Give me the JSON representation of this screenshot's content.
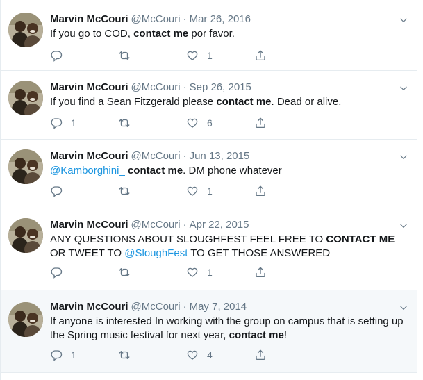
{
  "tweets": [
    {
      "name": "Marvin McCouri",
      "handle": "@McCouri",
      "separator": "·",
      "date": "Mar 26, 2016",
      "parts": [
        {
          "t": "If you go to COD, "
        },
        {
          "t": "contact me",
          "b": true
        },
        {
          "t": " por favor."
        }
      ],
      "replies": "",
      "retweets": "",
      "likes": "1"
    },
    {
      "name": "Marvin McCouri",
      "handle": "@McCouri",
      "separator": "·",
      "date": "Sep 26, 2015",
      "parts": [
        {
          "t": "If you find a Sean Fitzgerald please "
        },
        {
          "t": "contact me",
          "b": true
        },
        {
          "t": ". Dead or alive."
        }
      ],
      "replies": "1",
      "retweets": "",
      "likes": "6"
    },
    {
      "name": "Marvin McCouri",
      "handle": "@McCouri",
      "separator": "·",
      "date": "Jun 13, 2015",
      "parts": [
        {
          "t": "@Kamborghini_",
          "m": true
        },
        {
          "t": " "
        },
        {
          "t": "contact me",
          "b": true
        },
        {
          "t": ". DM phone whatever"
        }
      ],
      "replies": "",
      "retweets": "",
      "likes": "1"
    },
    {
      "name": "Marvin McCouri",
      "handle": "@McCouri",
      "separator": "·",
      "date": "Apr 22, 2015",
      "parts": [
        {
          "t": "ANY QUESTIONS ABOUT SLOUGHFEST FEEL FREE TO "
        },
        {
          "t": "CONTACT ME",
          "b": true
        },
        {
          "t": " OR TWEET TO "
        },
        {
          "t": "@SloughFest",
          "m": true
        },
        {
          "t": " TO GET THOSE ANSWERED"
        }
      ],
      "replies": "",
      "retweets": "",
      "likes": "1"
    },
    {
      "name": "Marvin McCouri",
      "handle": "@McCouri",
      "separator": "·",
      "date": "May 7, 2014",
      "parts": [
        {
          "t": "If anyone is interested In working with the group on campus that is setting up the Spring music festival for next year, "
        },
        {
          "t": "contact me",
          "b": true
        },
        {
          "t": "!"
        }
      ],
      "replies": "1",
      "retweets": "",
      "likes": "4"
    }
  ],
  "colors": {
    "text": "#14171a",
    "muted": "#657786",
    "link": "#1b95e0",
    "border": "#e6ecf0",
    "highlight": "#f5f8fa"
  },
  "icons": [
    "reply-icon",
    "retweet-icon",
    "like-icon",
    "share-icon",
    "chevron-down-icon"
  ]
}
